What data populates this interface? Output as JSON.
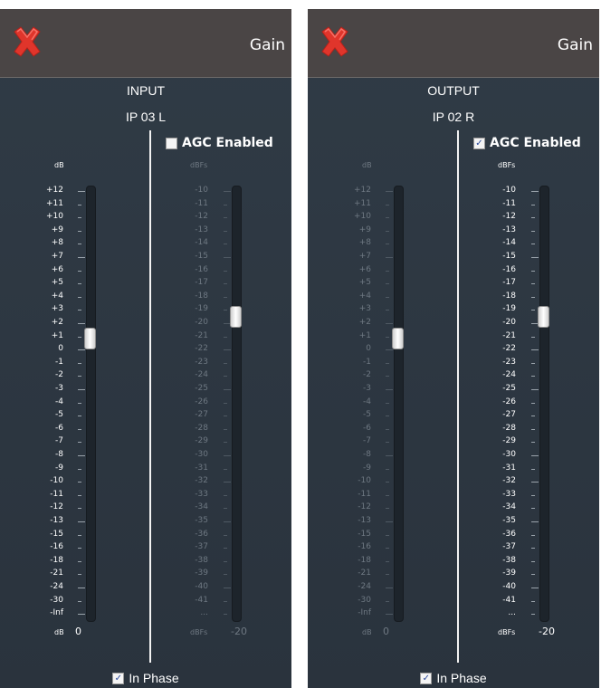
{
  "panels": [
    {
      "id": "input",
      "header_title": "Gain",
      "section_title": "INPUT",
      "port_name": "IP 03 L",
      "agc_label": "AGC Enabled",
      "agc_checked": false,
      "gain": {
        "unit_top": "dB",
        "unit_bottom": "dB",
        "value": "0",
        "enabled": true,
        "level": 0.65
      },
      "dbfs": {
        "unit_top": "dBFs",
        "unit_bottom": "dBFs",
        "value": "-20",
        "enabled": false,
        "level": 0.7
      },
      "in_phase_label": "In Phase",
      "in_phase_checked": true
    },
    {
      "id": "output",
      "header_title": "Gain",
      "section_title": "OUTPUT",
      "port_name": "IP 02 R",
      "agc_label": "AGC Enabled",
      "agc_checked": true,
      "gain": {
        "unit_top": "dB",
        "unit_bottom": "dB",
        "value": "0",
        "enabled": false,
        "level": 0.65
      },
      "dbfs": {
        "unit_top": "dBFs",
        "unit_bottom": "dBFs",
        "value": "-20",
        "enabled": true,
        "level": 0.7
      },
      "in_phase_label": "In Phase",
      "in_phase_checked": true
    }
  ],
  "gain_ticks": [
    "+12",
    "+11",
    "+10",
    "+9",
    "+8",
    "+7",
    "+6",
    "+5",
    "+4",
    "+3",
    "+2",
    "+1",
    "0",
    "-1",
    "-2",
    "-3",
    "-4",
    "-5",
    "-6",
    "-7",
    "-8",
    "-9",
    "-10",
    "-11",
    "-12",
    "-13",
    "-15",
    "-16",
    "-18",
    "-21",
    "-24",
    "-30",
    "-Inf"
  ],
  "dbfs_ticks": [
    "-10",
    "-11",
    "-12",
    "-13",
    "-14",
    "-15",
    "-16",
    "-17",
    "-18",
    "-19",
    "-20",
    "-21",
    "-22",
    "-23",
    "-24",
    "-25",
    "-26",
    "-27",
    "-28",
    "-29",
    "-30",
    "-31",
    "-32",
    "-33",
    "-34",
    "-35",
    "-36",
    "-37",
    "-38",
    "-39",
    "-40",
    "-41",
    "..."
  ],
  "icons": {
    "close": "close-x-icon",
    "checkbox": "checkbox-icon"
  },
  "colors": {
    "panel_bg": "#2c3640",
    "header_bg": "#4a4545",
    "close_red": "#e0352b",
    "text": "#ffffff",
    "disabled_text": "#6e7882"
  }
}
